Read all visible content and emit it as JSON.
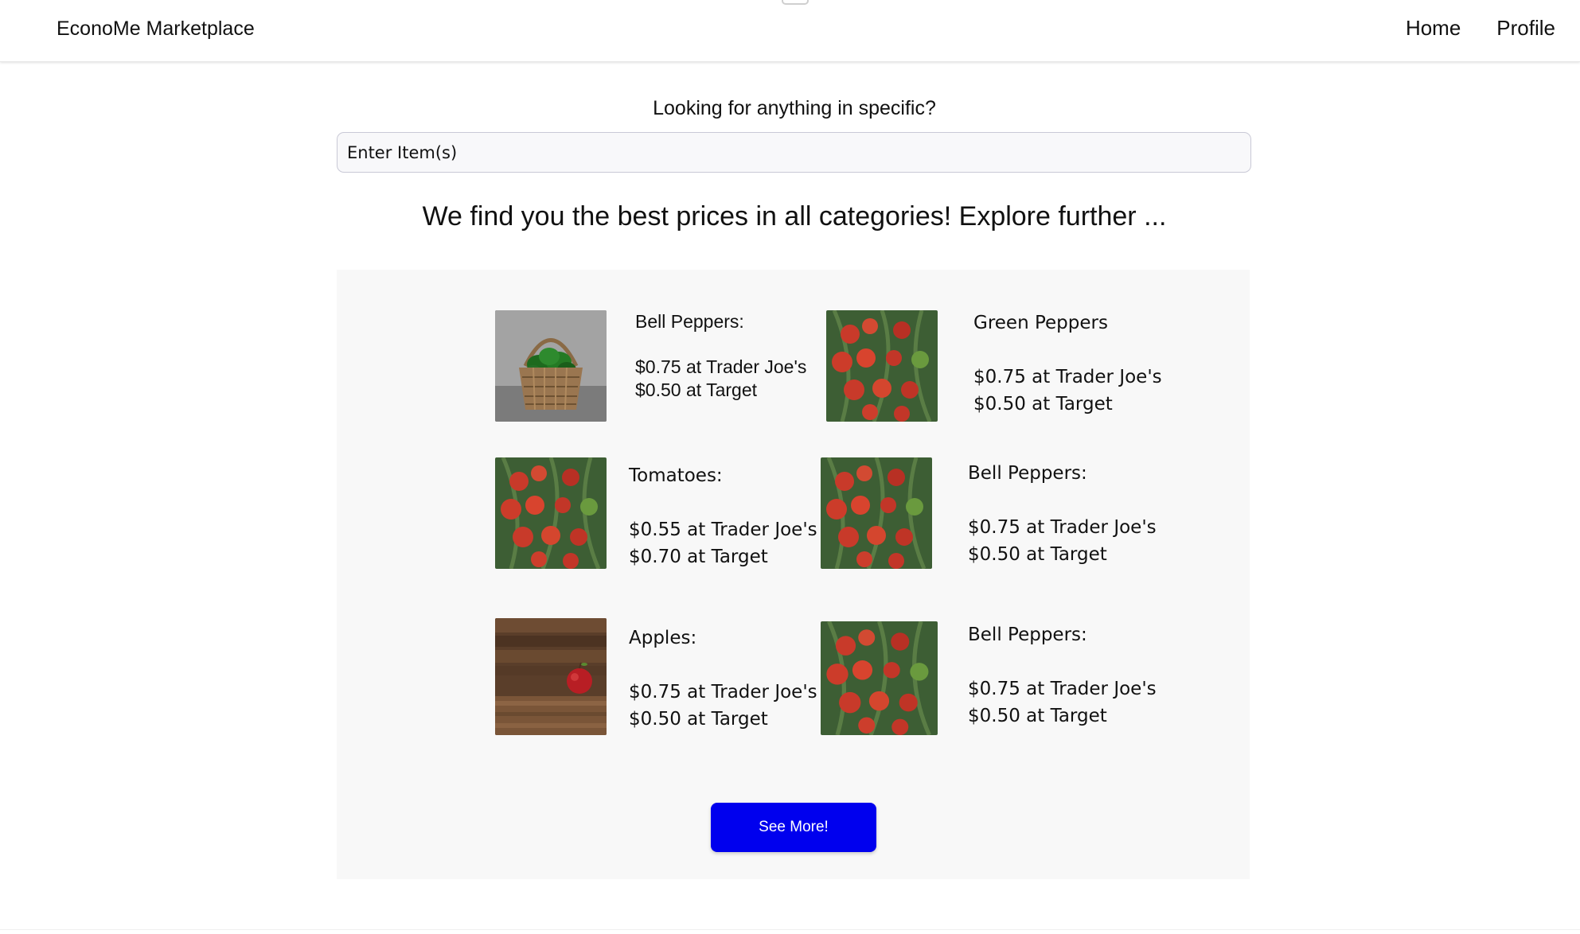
{
  "header": {
    "brand": "EconoMe Marketplace",
    "nav": [
      "Home",
      "Profile"
    ]
  },
  "search": {
    "label": "Looking for anything in specific?",
    "placeholder": "Enter Item(s)"
  },
  "headline": "We find you the best prices in all categories! Explore further ...",
  "products": [
    {
      "name": "Bell Peppers:",
      "price1": "$0.75 at Trader Joe's",
      "price2": "$0.50 at Target",
      "image": "peppers-basket"
    },
    {
      "name": "Green Peppers",
      "price1": "$0.75 at Trader Joe's",
      "price2": "$0.50 at Target",
      "image": "tomatoes-vine"
    },
    {
      "name": "Tomatoes:",
      "price1": "$0.55 at Trader Joe's",
      "price2": "$0.70 at Target",
      "image": "tomatoes-vine"
    },
    {
      "name": "Bell Peppers:",
      "price1": "$0.75 at Trader Joe's",
      "price2": "$0.50 at Target",
      "image": "tomatoes-vine"
    },
    {
      "name": "Apples:",
      "price1": "$0.75 at Trader Joe's",
      "price2": "$0.50 at Target",
      "image": "apple-on-wood"
    },
    {
      "name": "Bell Peppers:",
      "price1": "$0.75 at Trader Joe's",
      "price2": "$0.50 at Target",
      "image": "tomatoes-vine"
    }
  ],
  "see_more_label": "See More!",
  "colors": {
    "accent_button": "#0000ee",
    "panel_bg": "#f8f8f8"
  }
}
